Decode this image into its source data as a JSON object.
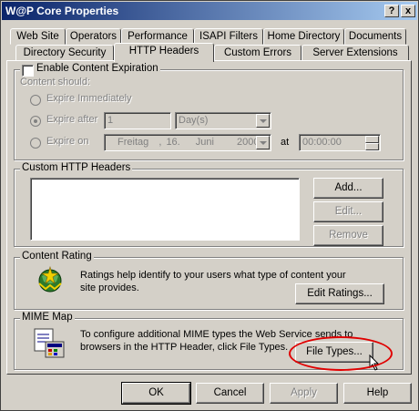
{
  "window": {
    "title": "W@P Core Properties",
    "help_btn": "?",
    "close_btn": "x"
  },
  "tabs_row1": [
    "Web Site",
    "Operators",
    "Performance",
    "ISAPI Filters",
    "Home Directory",
    "Documents"
  ],
  "tabs_row2": [
    "Directory Security",
    "HTTP Headers",
    "Custom Errors",
    "Server Extensions"
  ],
  "active_tab": "HTTP Headers",
  "expiration": {
    "enable_label": "Enable Content Expiration",
    "enabled": false,
    "content_should": "Content should:",
    "expire_immediately": "Expire Immediately",
    "expire_after": "Expire after",
    "expire_after_value": "1",
    "expire_after_unit": "Day(s)",
    "expire_on": "Expire on",
    "date_weekday": "Freitag",
    "date_sep": ",",
    "date_day": "16.",
    "date_month": "Juni",
    "date_year": "2000",
    "at_label": "at",
    "time_value": "00:00:00"
  },
  "custom_headers": {
    "legend": "Custom HTTP Headers",
    "add": "Add...",
    "edit": "Edit...",
    "remove": "Remove"
  },
  "rating": {
    "legend": "Content Rating",
    "text": "Ratings help identify to your users what type of content your site provides.",
    "edit_btn": "Edit Ratings..."
  },
  "mime": {
    "legend": "MIME Map",
    "text": "To configure additional MIME types the Web Service sends to browsers in the HTTP Header, click File Types.",
    "file_types_btn": "File Types..."
  },
  "dialog_buttons": {
    "ok": "OK",
    "cancel": "Cancel",
    "apply": "Apply",
    "help": "Help"
  },
  "colors": {
    "titlebar_start": "#0a246a",
    "titlebar_end": "#a6caf0",
    "highlight_oval": "#e00000",
    "face": "#d4d0c8"
  }
}
